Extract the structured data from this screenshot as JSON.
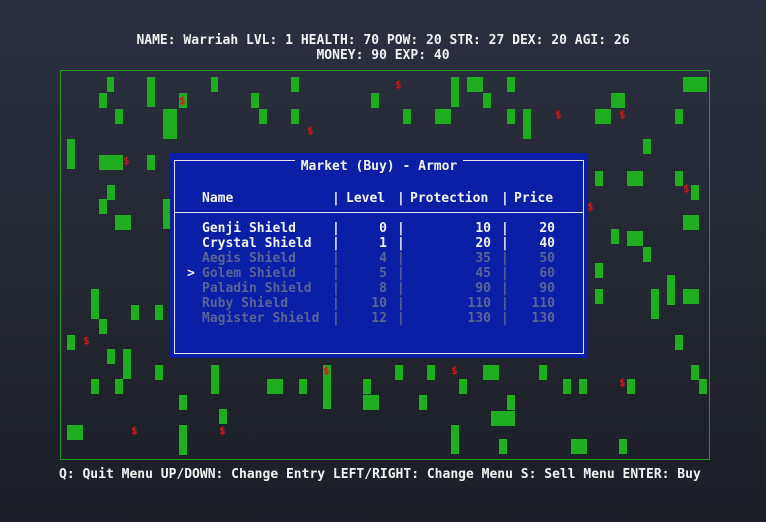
{
  "stats": {
    "line1": "NAME: Warriah  LVL: 1  HEALTH: 70  POW: 20  STR: 27  DEX: 20  AGI: 26",
    "line2": "MONEY: 90  EXP: 40"
  },
  "colors": {
    "wall": "#1fae1f",
    "coin": "#c21f1f",
    "panel": "#0a1fa6",
    "dim_text": "#5a6496"
  },
  "map": {
    "coin_symbol": "$"
  },
  "market": {
    "title": "Market (Buy) - Armor",
    "headers": {
      "name": "Name",
      "level": "Level",
      "protection": "Protection",
      "price": "Price",
      "sep": "|"
    },
    "cursor": ">",
    "selected_index": 3,
    "items": [
      {
        "name": "Genji Shield",
        "level": "0",
        "protection": "10",
        "price": "20",
        "affordable": true
      },
      {
        "name": "Crystal Shield",
        "level": "1",
        "protection": "20",
        "price": "40",
        "affordable": true
      },
      {
        "name": "Aegis Shield",
        "level": "4",
        "protection": "35",
        "price": "50",
        "affordable": false
      },
      {
        "name": "Golem Shield",
        "level": "5",
        "protection": "45",
        "price": "60",
        "affordable": false
      },
      {
        "name": "Paladin Shield",
        "level": "8",
        "protection": "90",
        "price": "90",
        "affordable": false
      },
      {
        "name": "Ruby Shield",
        "level": "10",
        "protection": "110",
        "price": "110",
        "affordable": false
      },
      {
        "name": "Magister Shield",
        "level": "12",
        "protection": "130",
        "price": "130",
        "affordable": false
      }
    ]
  },
  "help": "Q: Quit Menu  UP/DOWN: Change Entry  LEFT/RIGHT: Change Menu  S: Sell Menu  ENTER: Buy"
}
